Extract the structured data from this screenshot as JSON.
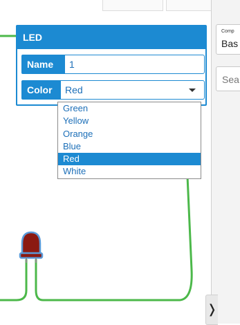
{
  "inspector": {
    "title": "LED",
    "name_label": "Name",
    "name_value": "1",
    "color_label": "Color",
    "color_value": "Red"
  },
  "color_dropdown": {
    "options": [
      "Green",
      "Yellow",
      "Orange",
      "Blue",
      "Red",
      "White"
    ],
    "selected": "Red"
  },
  "right_panel": {
    "components_label": "Comp",
    "components_value": "Bas",
    "search_placeholder": "Sea"
  },
  "collapse_toggle": {
    "glyph": "❭"
  },
  "colors": {
    "accent": "#1c8ad2",
    "wire": "#4cb84a",
    "led_body": "#8b1a12",
    "led_outline": "#5a9ad8"
  },
  "icons": [
    "chevron-right-icon",
    "caret-down-icon",
    "led-icon"
  ]
}
